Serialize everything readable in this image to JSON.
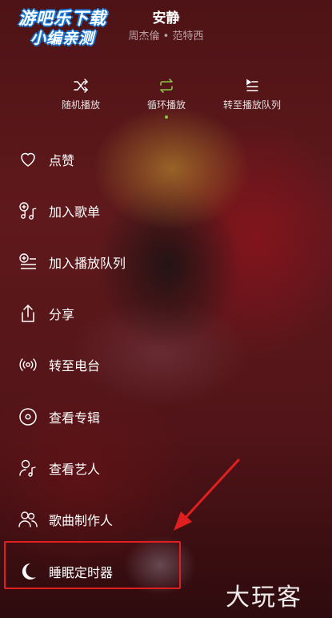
{
  "watermark_top": {
    "line1": "游吧乐下载",
    "line2": "小编亲测"
  },
  "now_playing": {
    "title": "安静",
    "artist": "周杰倫 • 范特西"
  },
  "play_modes": [
    {
      "label": "随机播放",
      "icon": "shuffle-icon"
    },
    {
      "label": "循环播放",
      "icon": "repeat-icon",
      "active": true,
      "active_color": "#8bc34a"
    },
    {
      "label": "转至播放队列",
      "icon": "queue-icon"
    }
  ],
  "menu": [
    {
      "label": "点赞",
      "icon": "heart-icon"
    },
    {
      "label": "加入歌单",
      "icon": "add-to-playlist-icon"
    },
    {
      "label": "加入播放队列",
      "icon": "add-to-queue-icon"
    },
    {
      "label": "分享",
      "icon": "share-icon"
    },
    {
      "label": "转至电台",
      "icon": "radio-icon"
    },
    {
      "label": "查看专辑",
      "icon": "album-icon"
    },
    {
      "label": "查看艺人",
      "icon": "artist-icon"
    },
    {
      "label": "歌曲制作人",
      "icon": "producers-icon"
    },
    {
      "label": "睡眠定时器",
      "icon": "moon-icon"
    }
  ],
  "annotation": {
    "highlight_color": "#e02020"
  },
  "watermark_bottom": "大玩客"
}
